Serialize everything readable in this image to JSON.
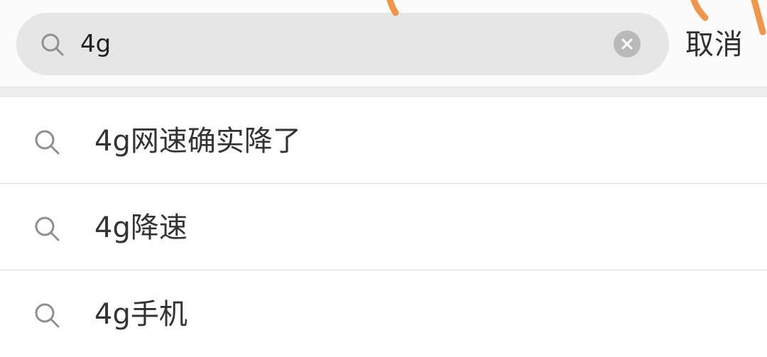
{
  "search": {
    "query": "4g",
    "cancel_label": "取消"
  },
  "suggestions": [
    {
      "text": "4g网速确实降了"
    },
    {
      "text": "4g降速"
    },
    {
      "text": "4g手机"
    }
  ],
  "icons": {
    "search": "search-icon",
    "clear": "clear-icon"
  },
  "colors": {
    "field_background": "#e6e6e6",
    "annotation_stroke": "#f0964a"
  }
}
